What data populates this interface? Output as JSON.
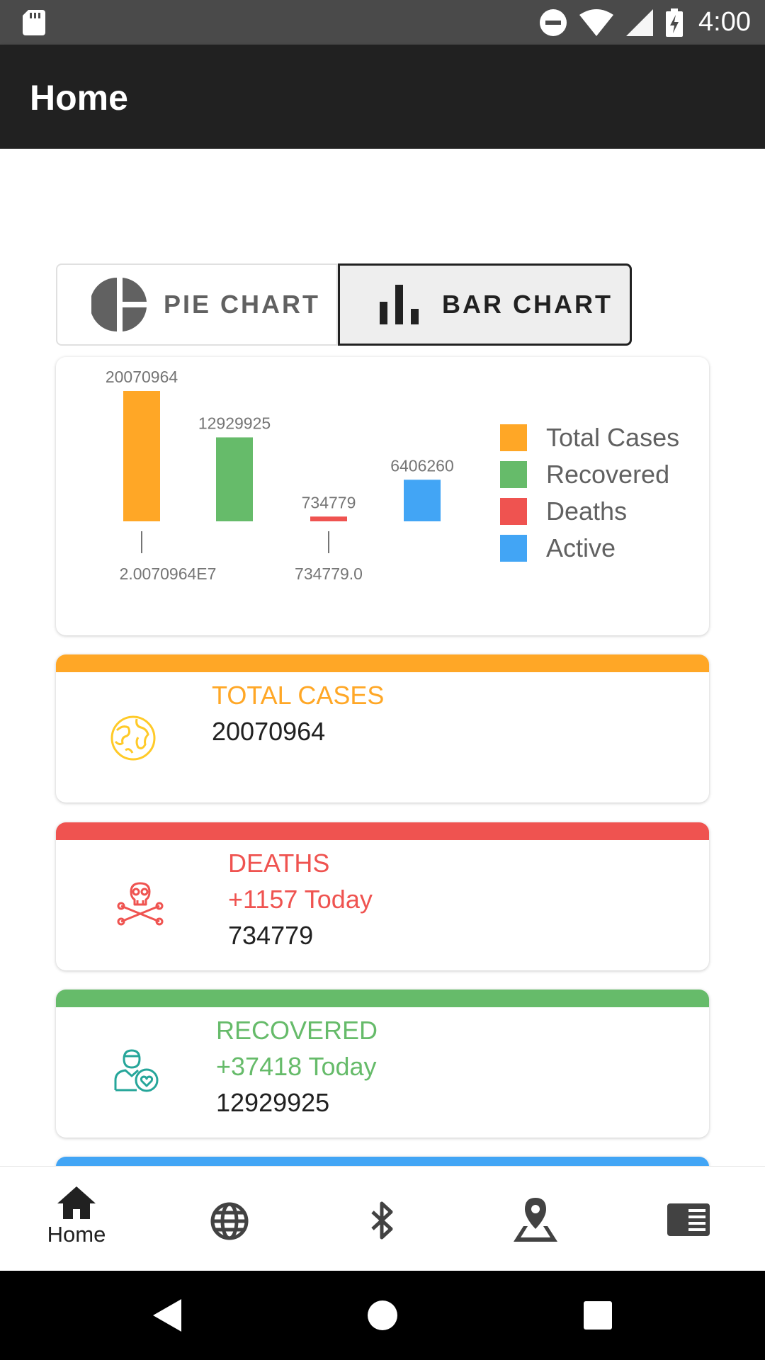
{
  "status_bar": {
    "time": "4:00",
    "icons": [
      "sd-card-icon",
      "do-not-disturb-icon",
      "wifi-icon",
      "signal-icon",
      "battery-charging-icon"
    ]
  },
  "app_bar": {
    "title": "Home"
  },
  "chart_toggle": {
    "pie_label": "PIE CHART",
    "bar_label": "BAR CHART",
    "selected": "BAR CHART"
  },
  "chart_data": {
    "type": "bar",
    "categories": [
      "Total Cases",
      "Recovered",
      "Deaths",
      "Active"
    ],
    "values": [
      20070964,
      12929925,
      734779,
      6406260
    ],
    "value_labels": [
      "20070964",
      "12929925",
      "734779",
      "6406260"
    ],
    "x_tick_labels": [
      "2.0070964E7",
      "734779.0"
    ],
    "colors": [
      "#ffa726",
      "#66bb6a",
      "#ef5350",
      "#42a5f5"
    ],
    "legend_position": "right",
    "grid": false
  },
  "legend": [
    {
      "label": "Total Cases",
      "color": "#ffa726"
    },
    {
      "label": "Recovered",
      "color": "#66bb6a"
    },
    {
      "label": "Deaths",
      "color": "#ef5350"
    },
    {
      "label": "Active",
      "color": "#42a5f5"
    }
  ],
  "cards": {
    "total": {
      "title": "TOTAL CASES",
      "value": "20070964",
      "color": "#ffa726",
      "icon": "globe-icon"
    },
    "deaths": {
      "title": "DEATHS",
      "today": "+1157 Today",
      "value": "734779",
      "color": "#ef5350",
      "icon": "skull-icon"
    },
    "recovered": {
      "title": "RECOVERED",
      "today": "+37418 Today",
      "value": "12929925",
      "color": "#66bb6a",
      "icon": "recovered-person-icon"
    },
    "active": {
      "color": "#42a5f5"
    }
  },
  "bottom_nav": {
    "items": [
      {
        "label": "Home",
        "icon": "home-icon"
      },
      {
        "label": "",
        "icon": "globe-icon"
      },
      {
        "label": "",
        "icon": "bluetooth-icon"
      },
      {
        "label": "",
        "icon": "map-pin-icon"
      },
      {
        "label": "",
        "icon": "news-icon"
      }
    ]
  },
  "system_nav": {
    "icons": [
      "back-icon",
      "home-circle-icon",
      "recents-icon"
    ]
  }
}
